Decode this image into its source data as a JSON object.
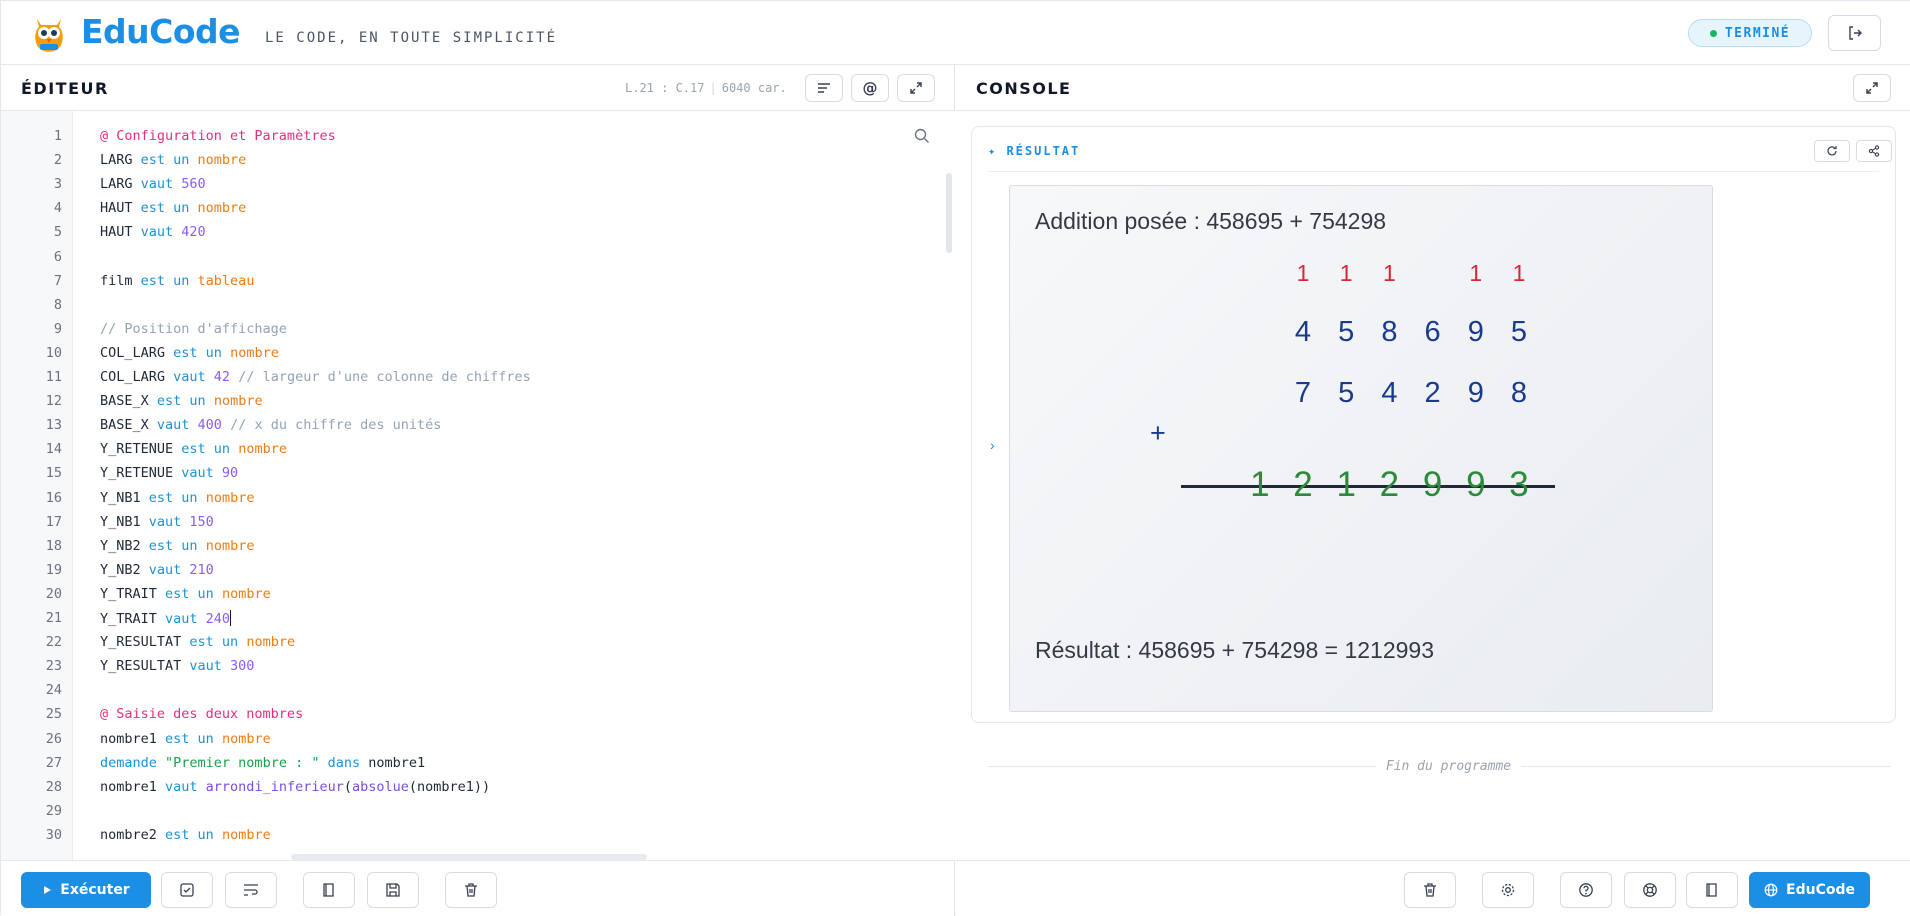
{
  "header": {
    "brand": "EduCode",
    "tagline": "LE CODE, EN TOUTE SIMPLICITÉ",
    "status": "TERMINÉ"
  },
  "editor": {
    "title": "ÉDITEUR",
    "cursor": "L.21 : C.17",
    "char_count": "6040 car.",
    "lines": [
      [
        [
          "@ Configuration et Paramètres",
          "dir"
        ]
      ],
      [
        [
          "LARG ",
          ""
        ],
        [
          "est un ",
          "kw"
        ],
        [
          "nombre",
          "type"
        ]
      ],
      [
        [
          "LARG ",
          ""
        ],
        [
          "vaut ",
          "kw"
        ],
        [
          "560",
          "num"
        ]
      ],
      [
        [
          "HAUT ",
          ""
        ],
        [
          "est un ",
          "kw"
        ],
        [
          "nombre",
          "type"
        ]
      ],
      [
        [
          "HAUT ",
          ""
        ],
        [
          "vaut ",
          "kw"
        ],
        [
          "420",
          "num"
        ]
      ],
      [],
      [
        [
          "film ",
          ""
        ],
        [
          "est un ",
          "kw"
        ],
        [
          "tableau",
          "type"
        ]
      ],
      [],
      [
        [
          "// Position d'affichage",
          "cm"
        ]
      ],
      [
        [
          "COL_LARG ",
          ""
        ],
        [
          "est un ",
          "kw"
        ],
        [
          "nombre",
          "type"
        ]
      ],
      [
        [
          "COL_LARG ",
          ""
        ],
        [
          "vaut ",
          "kw"
        ],
        [
          "42 ",
          "num"
        ],
        [
          "// largeur d'une colonne de chiffres",
          "cm"
        ]
      ],
      [
        [
          "BASE_X ",
          ""
        ],
        [
          "est un ",
          "kw"
        ],
        [
          "nombre",
          "type"
        ]
      ],
      [
        [
          "BASE_X ",
          ""
        ],
        [
          "vaut ",
          "kw"
        ],
        [
          "400 ",
          "num"
        ],
        [
          "// x du chiffre des unités",
          "cm"
        ]
      ],
      [
        [
          "Y_RETENUE ",
          ""
        ],
        [
          "est un ",
          "kw"
        ],
        [
          "nombre",
          "type"
        ]
      ],
      [
        [
          "Y_RETENUE ",
          ""
        ],
        [
          "vaut ",
          "kw"
        ],
        [
          "90",
          "num"
        ]
      ],
      [
        [
          "Y_NB1 ",
          ""
        ],
        [
          "est un ",
          "kw"
        ],
        [
          "nombre",
          "type"
        ]
      ],
      [
        [
          "Y_NB1 ",
          ""
        ],
        [
          "vaut ",
          "kw"
        ],
        [
          "150",
          "num"
        ]
      ],
      [
        [
          "Y_NB2 ",
          ""
        ],
        [
          "est un ",
          "kw"
        ],
        [
          "nombre",
          "type"
        ]
      ],
      [
        [
          "Y_NB2 ",
          ""
        ],
        [
          "vaut ",
          "kw"
        ],
        [
          "210",
          "num"
        ]
      ],
      [
        [
          "Y_TRAIT ",
          ""
        ],
        [
          "est un ",
          "kw"
        ],
        [
          "nombre",
          "type"
        ]
      ],
      [
        [
          "Y_TRAIT ",
          ""
        ],
        [
          "vaut ",
          "kw"
        ],
        [
          "240",
          "num"
        ],
        [
          "|",
          "caret"
        ]
      ],
      [
        [
          "Y_RESULTAT ",
          ""
        ],
        [
          "est un ",
          "kw"
        ],
        [
          "nombre",
          "type"
        ]
      ],
      [
        [
          "Y_RESULTAT ",
          ""
        ],
        [
          "vaut ",
          "kw"
        ],
        [
          "300",
          "num"
        ]
      ],
      [],
      [
        [
          "@ Saisie des deux nombres",
          "dir"
        ]
      ],
      [
        [
          "nombre1 ",
          ""
        ],
        [
          "est un ",
          "kw"
        ],
        [
          "nombre",
          "type"
        ]
      ],
      [
        [
          "demande ",
          "kw"
        ],
        [
          "\"Premier nombre : \" ",
          "str"
        ],
        [
          "dans ",
          "kw"
        ],
        [
          "nombre1",
          ""
        ]
      ],
      [
        [
          "nombre1 ",
          ""
        ],
        [
          "vaut ",
          "kw"
        ],
        [
          "arrondi_inferieur",
          "fn"
        ],
        [
          "(",
          ""
        ],
        [
          "absolue",
          "fn"
        ],
        [
          "(nombre1))",
          ""
        ]
      ],
      [],
      [
        [
          "nombre2 ",
          ""
        ],
        [
          "est un ",
          "kw"
        ],
        [
          "nombre",
          "type"
        ]
      ]
    ],
    "run_label": "Exécuter"
  },
  "console": {
    "title": "CONSOLE",
    "result_label": "✦ RÉSULTAT",
    "canvas": {
      "title": "Addition posée : 458695 + 754298",
      "carries": [
        "1",
        "1",
        "1",
        "",
        "1",
        "1"
      ],
      "number1": [
        "4",
        "5",
        "8",
        "6",
        "9",
        "5"
      ],
      "operator": "+",
      "number2": [
        "7",
        "5",
        "4",
        "2",
        "9",
        "8"
      ],
      "result": [
        "1",
        "2",
        "1",
        "2",
        "9",
        "9",
        "3"
      ],
      "summary": "Résultat : 458695 + 754298 = 1212993"
    },
    "end_label": "Fin du programme",
    "educode_label": "EduCode"
  },
  "colors": {
    "accent": "#1b8fe6",
    "carry": "#d62839",
    "operand": "#1a3a8c",
    "result": "#2c8a3a",
    "status_dot": "#19b36b"
  }
}
